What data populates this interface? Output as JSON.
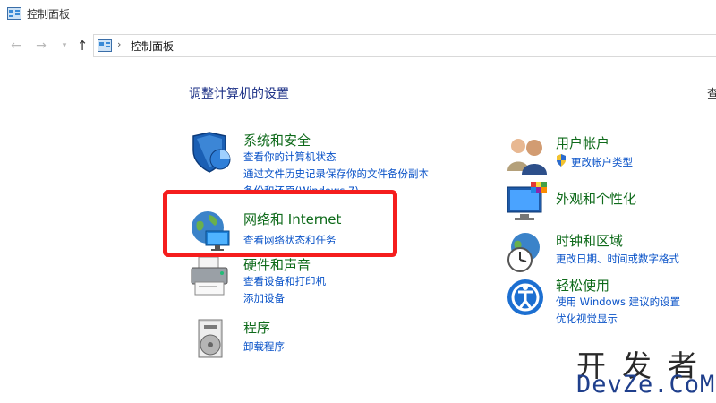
{
  "window": {
    "title": "控制面板",
    "icon": "control-panel-icon"
  },
  "nav": {
    "back_icon": "back-arrow-icon",
    "forward_icon": "forward-arrow-icon",
    "recent_icon": "chevron-down-icon",
    "up_icon": "up-arrow-icon",
    "breadcrumb_separator": "›",
    "address": "控制面板"
  },
  "main": {
    "heading": "调整计算机的设置",
    "view_by_cut": "查"
  },
  "categories": {
    "system_security": {
      "title": "系统和安全",
      "icon": "shield-icon",
      "links": [
        "查看你的计算机状态",
        "通过文件历史记录保存你的文件备份副本",
        "备份和还原(Windows 7)"
      ]
    },
    "network": {
      "title": "网络和 Internet",
      "icon": "network-globe-icon",
      "links": [
        "查看网络状态和任务"
      ]
    },
    "hardware": {
      "title": "硬件和声音",
      "icon": "printer-icon",
      "links": [
        "查看设备和打印机",
        "添加设备"
      ]
    },
    "programs": {
      "title": "程序",
      "icon": "programs-disc-icon",
      "links": [
        "卸载程序"
      ]
    },
    "user_accounts": {
      "title": "用户帐户",
      "icon": "users-icon",
      "links": [
        "更改帐户类型"
      ],
      "link_icon": "uac-shield-icon"
    },
    "appearance": {
      "title": "外观和个性化",
      "icon": "monitor-palette-icon",
      "links": []
    },
    "clock_region": {
      "title": "时钟和区域",
      "icon": "clock-globe-icon",
      "links": [
        "更改日期、时间或数字格式"
      ]
    },
    "ease_of_access": {
      "title": "轻松使用",
      "icon": "ease-of-access-icon",
      "links": [
        "使用 Windows 建议的设置",
        "优化视觉显示"
      ]
    }
  },
  "colors": {
    "heading": "#1e3287",
    "category_title": "#0e6a1a",
    "link": "#0a53c8",
    "highlight_border": "#f51d1d"
  },
  "watermark": {
    "line1": "开发者",
    "line2": "DevZe.CoM"
  }
}
